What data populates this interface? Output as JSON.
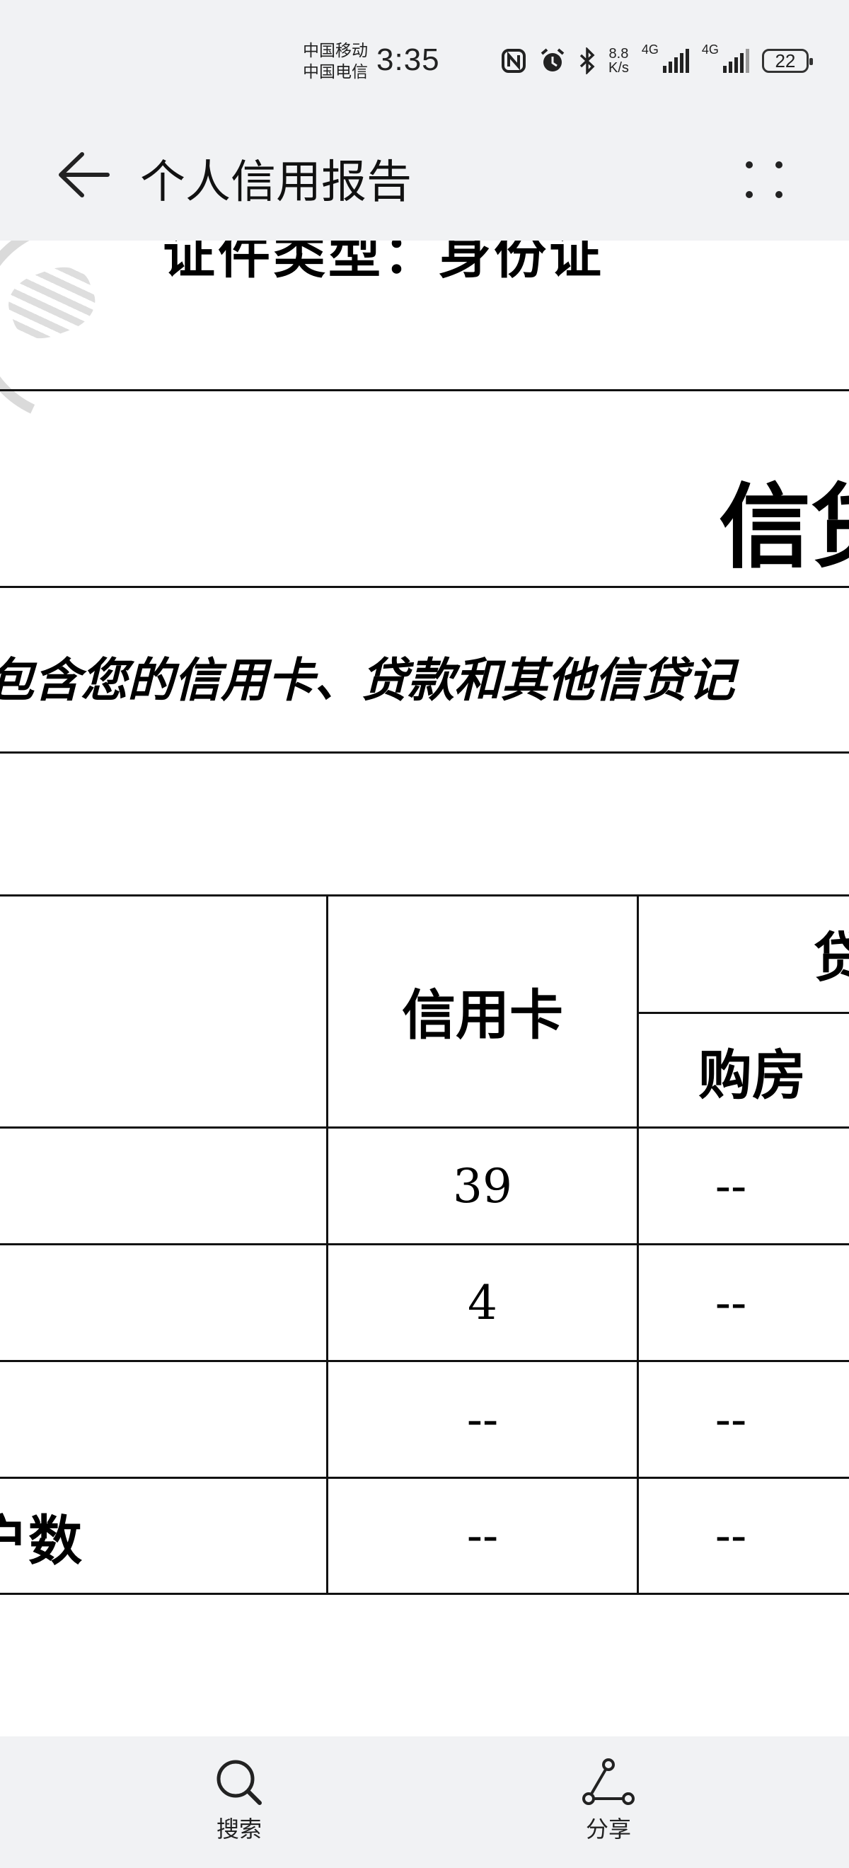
{
  "status_bar": {
    "carrier_1": "中国移动",
    "carrier_2": "中国电信",
    "time": "3:35",
    "net_speed_value": "8.8",
    "net_speed_unit": "K/s",
    "signal_1": "4G",
    "signal_2": "4G",
    "battery": "22"
  },
  "header": {
    "title": "个人信用报告",
    "back_icon": "arrow-left-icon",
    "more_icon": "more-dots-icon"
  },
  "document": {
    "id_type_line": "证件类型：身份证",
    "section_title": "信贷",
    "section_note": "包含您的信用卡、贷款和其他信贷记",
    "table": {
      "col_headers": [
        "信用卡",
        "贷",
        "购房"
      ],
      "rows": [
        {
          "label": "",
          "values": [
            "39",
            "--"
          ]
        },
        {
          "label": "",
          "values": [
            "4",
            "--"
          ]
        },
        {
          "label": "",
          "values": [
            "--",
            "--"
          ]
        },
        {
          "label": "户数",
          "values": [
            "--",
            "--"
          ]
        }
      ]
    }
  },
  "bottom_bar": {
    "search_label": "搜索",
    "search_icon": "search-icon",
    "share_label": "分享",
    "share_icon": "share-icon"
  }
}
